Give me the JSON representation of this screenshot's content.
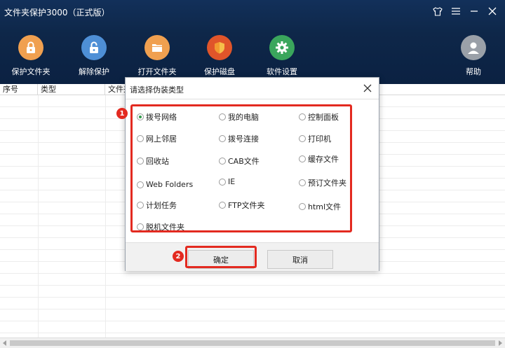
{
  "window": {
    "title": "文件夹保护3000（正式版）"
  },
  "toolbar": [
    {
      "label": "保护文件夹",
      "icon": "folder-lock-icon",
      "color": "#f0a050"
    },
    {
      "label": "解除保护",
      "icon": "folder-unlock-icon",
      "color": "#4e8fd6"
    },
    {
      "label": "打开文件夹",
      "icon": "open-folder-icon",
      "color": "#f0a050"
    },
    {
      "label": "保护磁盘",
      "icon": "shield-icon",
      "color": "#e0552a"
    },
    {
      "label": "软件设置",
      "icon": "gear-icon",
      "color": "#3aa65c"
    },
    {
      "label": "帮助",
      "icon": "user-help-icon",
      "color": "#9aa0a8"
    }
  ],
  "table": {
    "columns": [
      "序号",
      "类型",
      "文件夹"
    ]
  },
  "dialog": {
    "title": "请选择伪装类型",
    "options": [
      {
        "label": "拨号网络",
        "checked": true
      },
      {
        "label": "我的电脑",
        "checked": false
      },
      {
        "label": "控制面板",
        "checked": false
      },
      {
        "label": "网上邻居",
        "checked": false
      },
      {
        "label": "拨号连接",
        "checked": false
      },
      {
        "label": "打印机",
        "checked": false
      },
      {
        "label": "回收站",
        "checked": false
      },
      {
        "label": "CAB文件",
        "checked": false
      },
      {
        "label": "缓存文件",
        "checked": false
      },
      {
        "label": "Web Folders",
        "checked": false
      },
      {
        "label": "IE",
        "checked": false
      },
      {
        "label": "预订文件夹",
        "checked": false
      },
      {
        "label": "计划任务",
        "checked": false
      },
      {
        "label": "FTP文件夹",
        "checked": false
      },
      {
        "label": "html文件",
        "checked": false
      },
      {
        "label": "脱机文件夹",
        "checked": false
      }
    ],
    "ok_label": "确定",
    "cancel_label": "取消"
  },
  "annotations": {
    "badge1": "1",
    "badge2": "2"
  },
  "colors": {
    "header": "#0e2749",
    "annotation": "#e32a20",
    "radio_checked": "#2f9a4a"
  }
}
